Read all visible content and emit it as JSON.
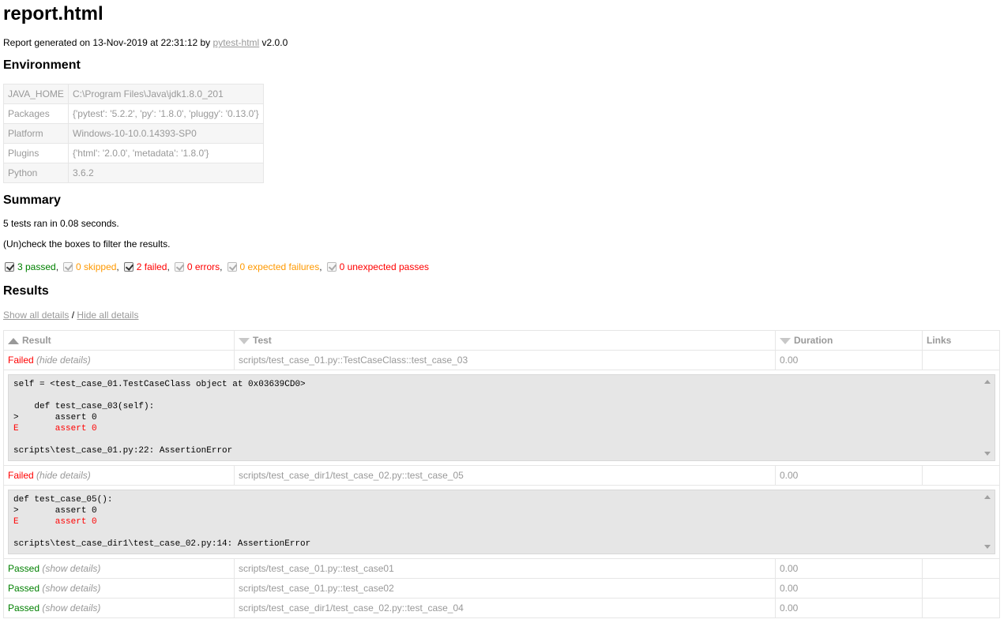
{
  "page_title": "report.html",
  "generated": {
    "prefix": "Report generated on 13-Nov-2019 at 22:31:12 by ",
    "link_text": "pytest-html",
    "suffix": " v2.0.0"
  },
  "environment": {
    "heading": "Environment",
    "rows": [
      {
        "key": "JAVA_HOME",
        "value": "C:\\Program Files\\Java\\jdk1.8.0_201"
      },
      {
        "key": "Packages",
        "value": "{'pytest': '5.2.2', 'py': '1.8.0', 'pluggy': '0.13.0'}"
      },
      {
        "key": "Platform",
        "value": "Windows-10-10.0.14393-SP0"
      },
      {
        "key": "Plugins",
        "value": "{'html': '2.0.0', 'metadata': '1.8.0'}"
      },
      {
        "key": "Python",
        "value": "3.6.2"
      }
    ]
  },
  "summary": {
    "heading": "Summary",
    "ran_text": "5 tests ran in 0.08 seconds.",
    "filter_hint": "(Un)check the boxes to filter the results.",
    "filters": [
      {
        "label": "3 passed",
        "sep": ",",
        "checked": true,
        "enabled": true,
        "color": "#008000"
      },
      {
        "label": "0 skipped",
        "sep": ",",
        "checked": true,
        "enabled": false,
        "color": "#ff9900"
      },
      {
        "label": "2 failed",
        "sep": ",",
        "checked": true,
        "enabled": true,
        "color": "#ff0000"
      },
      {
        "label": "0 errors",
        "sep": ",",
        "checked": true,
        "enabled": false,
        "color": "#ff0000"
      },
      {
        "label": "0 expected failures",
        "sep": ",",
        "checked": true,
        "enabled": false,
        "color": "#ff9900"
      },
      {
        "label": "0 unexpected passes",
        "sep": "",
        "checked": true,
        "enabled": false,
        "color": "#ff0000"
      }
    ]
  },
  "results": {
    "heading": "Results",
    "show_all": "Show all details",
    "separator": "/",
    "hide_all": "Hide all details",
    "columns": {
      "result": "Result",
      "test": "Test",
      "duration": "Duration",
      "links": "Links"
    },
    "rows": [
      {
        "result": "Failed",
        "toggle": "(hide details)",
        "test": "scripts/test_case_01.py::TestCaseClass::test_case_03",
        "duration": "0.00",
        "links": "",
        "log": [
          {
            "text": "self = <test_case_01.TestCaseClass object at 0x03639CD0>",
            "error": false
          },
          {
            "text": "",
            "error": false
          },
          {
            "text": "    def test_case_03(self):",
            "error": false
          },
          {
            "text": ">       assert 0",
            "error": false
          },
          {
            "text": "E       assert 0",
            "error": true
          },
          {
            "text": "",
            "error": false
          },
          {
            "text": "scripts\\test_case_01.py:22: AssertionError",
            "error": false
          }
        ]
      },
      {
        "result": "Failed",
        "toggle": "(hide details)",
        "test": "scripts/test_case_dir1/test_case_02.py::test_case_05",
        "duration": "0.00",
        "links": "",
        "log": [
          {
            "text": "def test_case_05():",
            "error": false
          },
          {
            "text": ">       assert 0",
            "error": false
          },
          {
            "text": "E       assert 0",
            "error": true
          },
          {
            "text": "",
            "error": false
          },
          {
            "text": "scripts\\test_case_dir1\\test_case_02.py:14: AssertionError",
            "error": false
          }
        ]
      },
      {
        "result": "Passed",
        "toggle": "(show details)",
        "test": "scripts/test_case_01.py::test_case01",
        "duration": "0.00",
        "links": "",
        "log": []
      },
      {
        "result": "Passed",
        "toggle": "(show details)",
        "test": "scripts/test_case_01.py::test_case02",
        "duration": "0.00",
        "links": "",
        "log": []
      },
      {
        "result": "Passed",
        "toggle": "(show details)",
        "test": "scripts/test_case_dir1/test_case_02.py::test_case_04",
        "duration": "0.00",
        "links": "",
        "log": []
      }
    ]
  }
}
